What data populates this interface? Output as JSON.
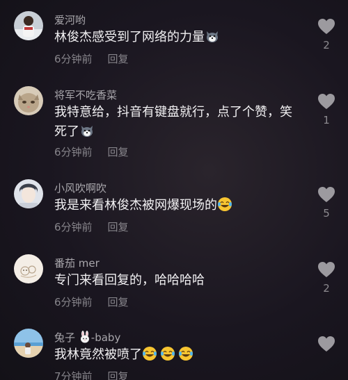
{
  "comments": [
    {
      "username": "爱河哟",
      "text": "林俊杰感受到了网络的力量",
      "text_emoji": [
        "husky-emoji"
      ],
      "time": "6分钟前",
      "reply_label": "回复",
      "likes": "2"
    },
    {
      "username": "将军不吃香菜",
      "text": "我特意给，抖音有键盘就行，点了个赞，笑死了",
      "text_emoji": [
        "husky-emoji"
      ],
      "time": "6分钟前",
      "reply_label": "回复",
      "likes": "1"
    },
    {
      "username": "小风吹啊吹",
      "text": "我是来看林俊杰被网爆现场的",
      "text_emoji": [
        "laughing-tears-emoji"
      ],
      "time": "6分钟前",
      "reply_label": "回复",
      "likes": "5"
    },
    {
      "username": "番茄 mer",
      "text": "专门来看回复的，哈哈哈哈",
      "text_emoji": [],
      "time": "6分钟前",
      "reply_label": "回复",
      "likes": "2"
    },
    {
      "username": "兔子",
      "username_suffix": "-baby",
      "username_emoji": "rabbit-emoji",
      "text": "我林竟然被喷了",
      "text_emoji": [
        "laughing-tears-emoji",
        "laughing-tears-emoji",
        "laughing-tears-emoji"
      ],
      "time": "7分钟前",
      "reply_label": "回复",
      "likes": ""
    }
  ],
  "colors": {
    "background": "#1a1620",
    "username": "#a9a7ac",
    "text": "#f2f1f3",
    "meta": "#87858b",
    "like_icon": "#9c9a9f"
  }
}
